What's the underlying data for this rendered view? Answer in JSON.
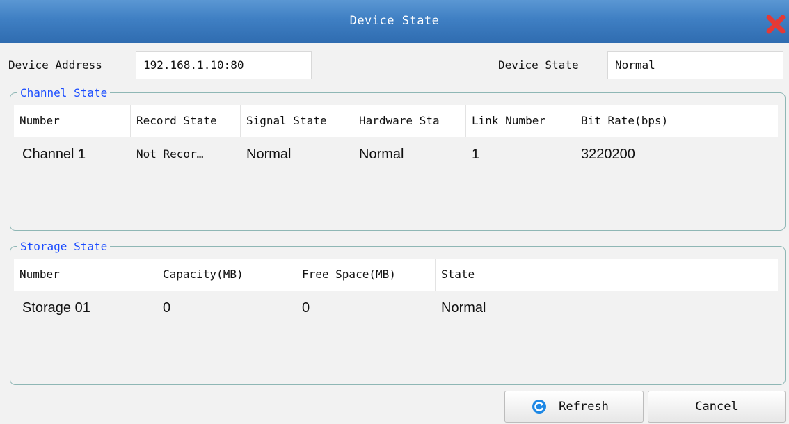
{
  "window": {
    "title": "Device State"
  },
  "top": {
    "device_address_label": "Device Address",
    "device_address_value": "192.168.1.10:80",
    "device_state_label": "Device State",
    "device_state_value": "Normal"
  },
  "channel": {
    "group_title": "Channel State",
    "columns": [
      "Number",
      "Record State",
      "Signal State",
      "Hardware Sta",
      "Link Number",
      "Bit Rate(bps)"
    ],
    "rows": [
      [
        "Channel 1",
        "Not Recor…",
        "Normal",
        "Normal",
        "1",
        "3220200"
      ]
    ]
  },
  "storage": {
    "group_title": "Storage State",
    "columns": [
      "Number",
      "Capacity(MB)",
      "Free Space(MB)",
      "State"
    ],
    "rows": [
      [
        "Storage 01",
        "0",
        "0",
        "Normal"
      ]
    ]
  },
  "buttons": {
    "refresh": "Refresh",
    "cancel": "Cancel"
  },
  "colors": {
    "titlebar": "#3f7fc3",
    "group_title": "#1a4cff",
    "group_border": "#8fb7b5",
    "close": "#e53935",
    "refresh_icon": "#1e88e5"
  },
  "icons": {
    "close": "close-icon",
    "refresh": "refresh-icon"
  }
}
